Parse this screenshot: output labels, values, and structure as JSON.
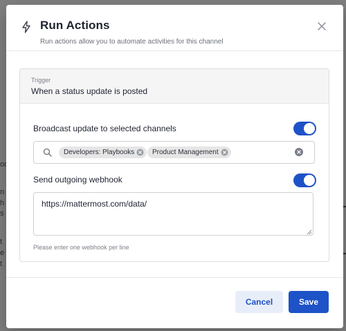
{
  "modal": {
    "title": "Run Actions",
    "subtitle": "Run actions allow you to automate activities for this channel",
    "icon": "lightning-bolt-icon",
    "close_icon": "close-icon"
  },
  "trigger": {
    "label": "Trigger",
    "value": "When a status update is posted"
  },
  "broadcast": {
    "label": "Broadcast update to selected channels",
    "enabled": true,
    "channels": [
      {
        "label": "Developers: Playbooks"
      },
      {
        "label": "Product Management"
      }
    ]
  },
  "webhook": {
    "label": "Send outgoing webhook",
    "enabled": true,
    "value": "https://mattermost.com/data/",
    "help": "Please enter one webhook per line"
  },
  "footer": {
    "cancel_label": "Cancel",
    "save_label": "Save"
  },
  "colors": {
    "accent": "#1e52c7",
    "cancel_bg": "#e8eef9"
  }
}
